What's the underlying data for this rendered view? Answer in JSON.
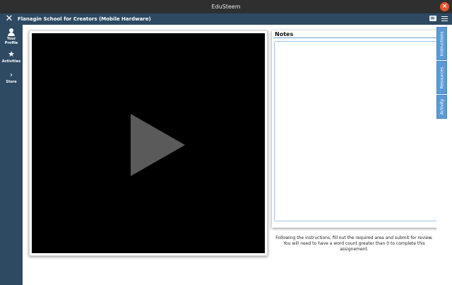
{
  "window": {
    "title": "EduSteem"
  },
  "header": {
    "title": "Flanagin School for Creators (Mobile Hardware)"
  },
  "sidebar": {
    "items": [
      {
        "label": "Your\nProfile",
        "icon": "user-icon"
      },
      {
        "label": "Activities",
        "icon": "star-icon"
      },
      {
        "label": "Store",
        "icon": "chevron-right-icon"
      }
    ]
  },
  "notes": {
    "title": "Notes",
    "value": ""
  },
  "instructions": "Following the instructions, fill out the required area and submit for review. You will need to have a word count greater than 0 to complete this assignement.",
  "right_tabs": [
    "Instructions",
    "Resources",
    "Activity"
  ],
  "colors": {
    "accent": "#2d4a62",
    "tab": "#5b9bd5",
    "os_close": "#e9542c"
  }
}
